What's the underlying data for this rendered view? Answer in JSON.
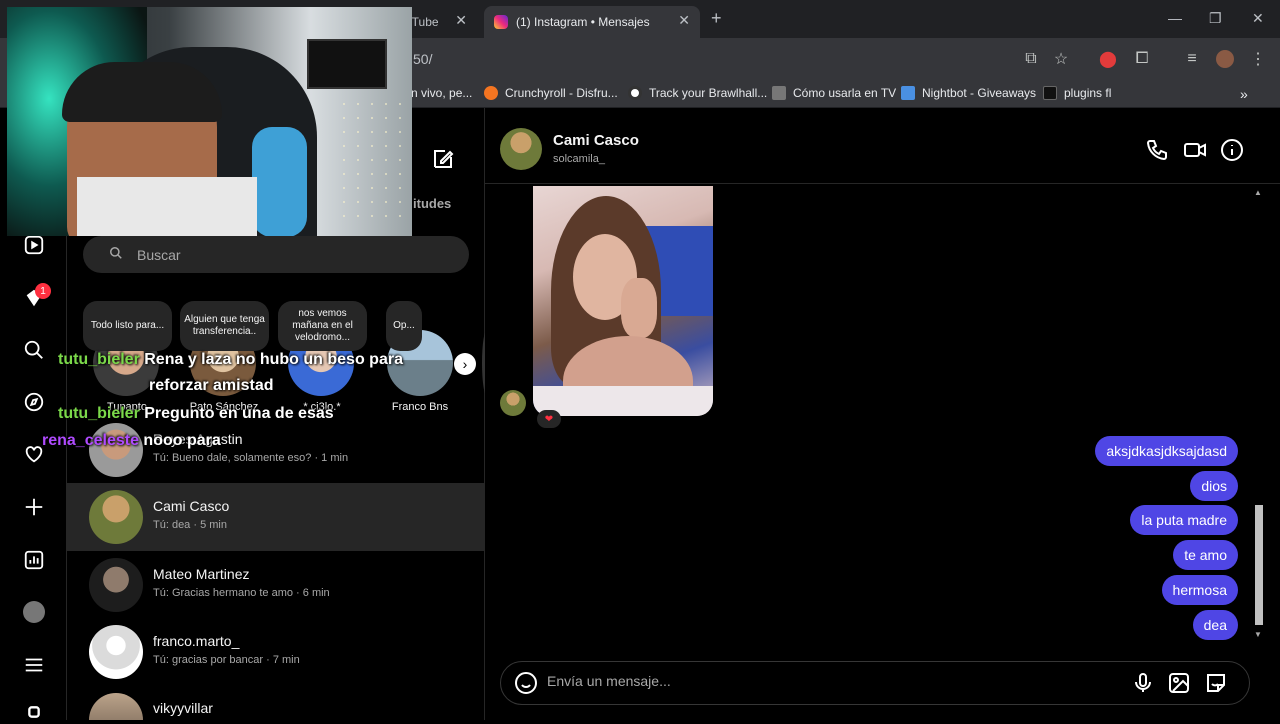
{
  "browser": {
    "tabs": [
      {
        "label": "uTube",
        "active": false
      },
      {
        "label": "(1) Instagram • Mensajes",
        "active": true
      }
    ],
    "url_fragment": "50/",
    "bookmarks": [
      {
        "label": "n vivo, pe...",
        "color": "#888888"
      },
      {
        "label": "Crunchyroll - Disfru...",
        "color": "#f47521"
      },
      {
        "label": "Track your Brawlhall...",
        "color": "#ffffff"
      },
      {
        "label": "Cómo usarla en TV",
        "color": "#4a4a4a"
      },
      {
        "label": "Nightbot - Giveaways",
        "color": "#4a90e2"
      },
      {
        "label": "plugins fl",
        "color": "#000000"
      }
    ]
  },
  "sidebar": {
    "notification_count": "1",
    "items": [
      "reels-icon",
      "notifications-icon",
      "search-icon",
      "explore-icon",
      "heart-icon",
      "create-icon",
      "stats-icon",
      "profile-avatar",
      "menu-icon",
      "more-icon"
    ]
  },
  "inbox": {
    "requests_label": "itudes",
    "search_placeholder": "Buscar",
    "notes": [
      {
        "text": "Todo listo para...",
        "name": "Tupapto"
      },
      {
        "text": "Alguien que tenga transferencia..",
        "name": "Pato Sánchez"
      },
      {
        "text": "nos vemos mañana en el velodromo...",
        "name": "*.ci3lo.*"
      },
      {
        "text": "Op...",
        "name": "Franco Bns"
      }
    ],
    "conversations": [
      {
        "name": "Reyes Agustin",
        "preview": "Tú: Bueno dale, solamente eso? · 1 min",
        "selected": false
      },
      {
        "name": "Cami Casco",
        "preview": "Tú: dea · 5 min",
        "selected": true
      },
      {
        "name": "Mateo Martinez",
        "preview": "Tú: Gracias hermano te amo · 6 min",
        "selected": false
      },
      {
        "name": "franco.marto_",
        "preview": "Tú: gracias por bancar · 7 min",
        "selected": false
      },
      {
        "name": "vikyyvillar",
        "preview": "",
        "selected": false
      }
    ]
  },
  "chat": {
    "name": "Cami Casco",
    "username": "solcamila_",
    "reaction": "❤",
    "messages": [
      "aksjdkasjdksajdasd",
      "dios",
      "la puta madre",
      "te amo",
      "hermosa",
      "dea"
    ],
    "composer_placeholder": "Envía un mensaje..."
  },
  "stream_chat": [
    {
      "user": "tutu_bieler",
      "msg": "Rena y laza no hubo un beso para",
      "color": "#7bd94a"
    },
    {
      "user": "",
      "msg": "reforzar amistad",
      "color": "#7bd94a"
    },
    {
      "user": "tutu_bieler",
      "msg": "Pregunto en una de esas",
      "color": "#7bd94a"
    },
    {
      "user": "rena_celeste",
      "msg": "nooo para",
      "color": "#b04bff"
    }
  ]
}
